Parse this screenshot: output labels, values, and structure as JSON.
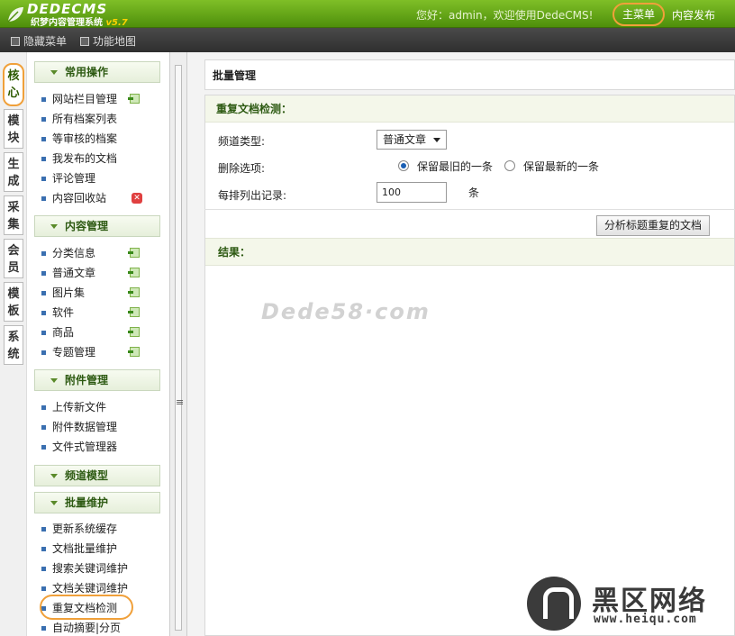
{
  "topbar": {
    "logo_text": "DEDECMS",
    "logo_sub": "织梦内容管理系统",
    "logo_version": "v5.7",
    "greeting": "您好：admin，欢迎使用DedeCMS!",
    "main_menu": "主菜单",
    "publish": "内容发布"
  },
  "subbar": {
    "hide_menu": "隐藏菜单",
    "func_map": "功能地图"
  },
  "left_tabs": [
    {
      "label": "核心"
    },
    {
      "label": "模块"
    },
    {
      "label": "生成"
    },
    {
      "label": "采集"
    },
    {
      "label": "会员"
    },
    {
      "label": "模板"
    },
    {
      "label": "系统"
    }
  ],
  "sidebar": {
    "groups": [
      {
        "title": "常用操作",
        "items": [
          "网站栏目管理",
          "所有档案列表",
          "等审核的档案",
          "我发布的文档",
          "评论管理",
          "内容回收站"
        ]
      },
      {
        "title": "内容管理",
        "items": [
          "分类信息",
          "普通文章",
          "图片集",
          "软件",
          "商品",
          "专题管理"
        ]
      },
      {
        "title": "附件管理",
        "items": [
          "上传新文件",
          "附件数据管理",
          "文件式管理器"
        ]
      },
      {
        "title": "频道模型",
        "items": []
      },
      {
        "title": "批量维护",
        "items": [
          "更新系统缓存",
          "文档批量维护",
          "搜索关键词维护",
          "文档关键词维护",
          "重复文档检测",
          "自动摘要|分页"
        ]
      }
    ]
  },
  "content": {
    "page_title": "批量管理",
    "section_title": "重复文档检测：",
    "channel_label": "频道类型:",
    "channel_value": "普通文章",
    "delete_label": "删除选项:",
    "keep_oldest": "保留最旧的一条",
    "keep_newest": "保留最新的一条",
    "per_row_label": "每排列出记录:",
    "per_row_value": "100",
    "per_row_unit": "条",
    "analyze_button": "分析标题重复的文档",
    "result_title": "结果：",
    "watermark": "Dede58·com"
  },
  "brand": {
    "name": "黑区网络",
    "url": "www.heiqu.com"
  },
  "colors": {
    "accent": "#f0a03a",
    "topbar": "#6aae1c",
    "group_text": "#2d5a12"
  }
}
